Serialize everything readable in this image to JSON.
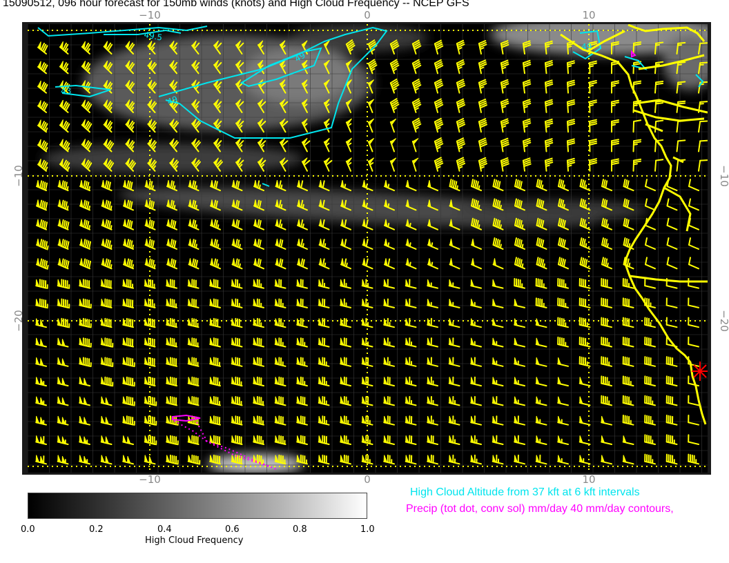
{
  "title": "15090512, 096 hour forecast for 150mb winds (knots) and High Cloud Frequency -- NCEP GFS",
  "map": {
    "lon_ticks": [
      "−10",
      "0",
      "10"
    ],
    "lat_ticks": [
      "−10",
      "−20"
    ],
    "contour_labels": [
      "49.5",
      "49",
      "43",
      "49",
      "49"
    ],
    "colors": {
      "background": "#000000",
      "wind_barbs": "#ffff00",
      "coastline": "#ffff00",
      "cloud_altitude_contours": "#00e5ee",
      "precip_contours": "#ff00ff",
      "grid_dotted": "#ffff00",
      "station_marker": "#ff0000"
    }
  },
  "colorbar": {
    "title": "High Cloud Frequency",
    "ticks": [
      "0.0",
      "0.2",
      "0.4",
      "0.6",
      "0.8",
      "1.0"
    ]
  },
  "legend": {
    "cloud_altitude": "High Cloud Altitude from 37 kft at 6 kft intervals",
    "precip": "Precip (tot dot, conv sol) mm/day 40 mm/day contours,"
  }
}
